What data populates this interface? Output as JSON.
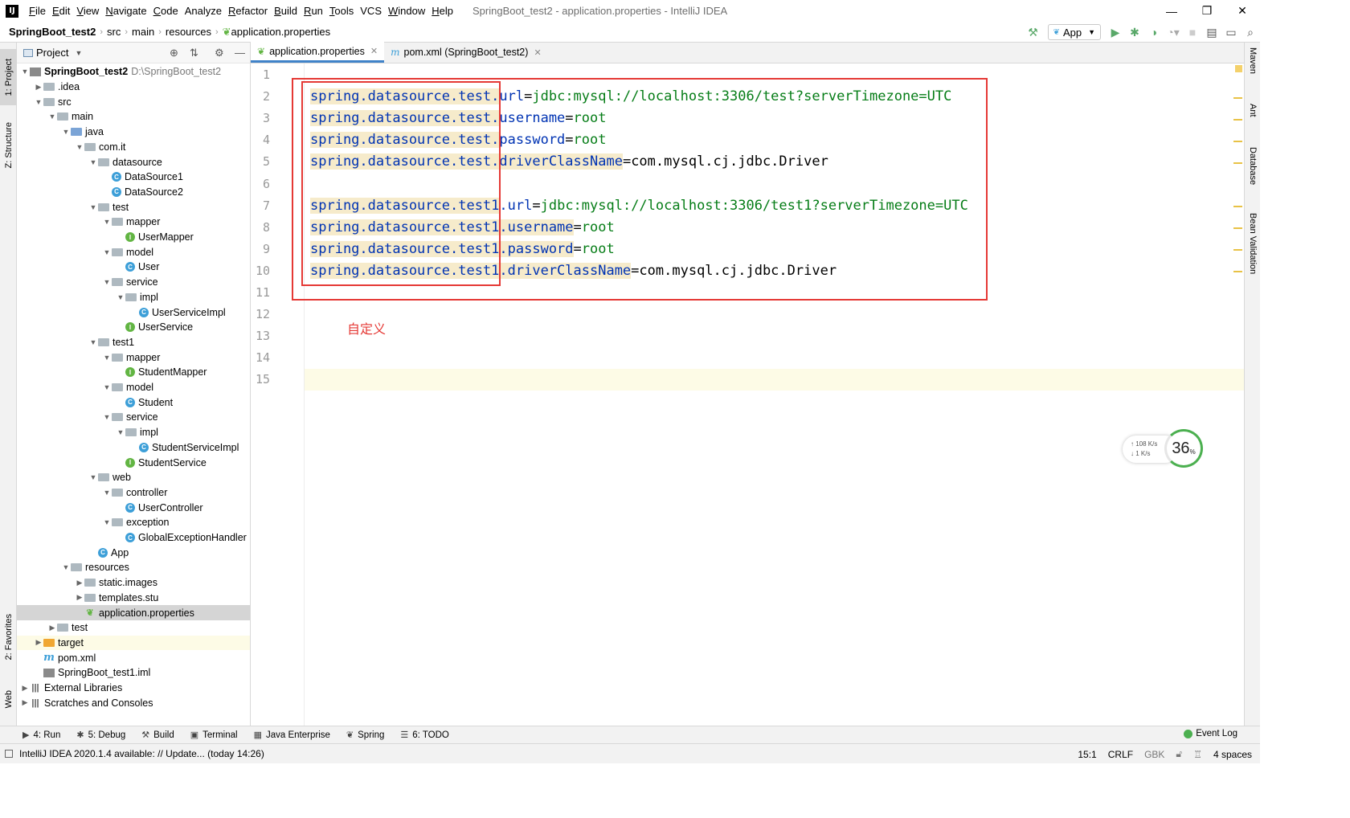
{
  "menubar": {
    "logo": "IJ",
    "items": [
      {
        "label": "File",
        "mnemonic": "F",
        "rest": "ile"
      },
      {
        "label": "Edit",
        "mnemonic": "E",
        "rest": "dit"
      },
      {
        "label": "View",
        "mnemonic": "V",
        "rest": "iew"
      },
      {
        "label": "Navigate",
        "mnemonic": "N",
        "rest": "avigate"
      },
      {
        "label": "Code",
        "mnemonic": "C",
        "rest": "ode"
      },
      {
        "label": "Analyze",
        "mnemonic": "",
        "rest": "Analyze"
      },
      {
        "label": "Refactor",
        "mnemonic": "R",
        "rest": "efactor"
      },
      {
        "label": "Build",
        "mnemonic": "B",
        "rest": "uild"
      },
      {
        "label": "Run",
        "mnemonic": "R",
        "rest": "un"
      },
      {
        "label": "Tools",
        "mnemonic": "T",
        "rest": "ools"
      },
      {
        "label": "VCS",
        "mnemonic": "",
        "rest": "VCS"
      },
      {
        "label": "Window",
        "mnemonic": "W",
        "rest": "indow"
      },
      {
        "label": "Help",
        "mnemonic": "H",
        "rest": "elp"
      }
    ],
    "window_title": "SpringBoot_test2 - application.properties - IntelliJ IDEA",
    "window_buttons": [
      "—",
      "❐",
      "✕"
    ]
  },
  "navbar": {
    "crumbs": [
      "SpringBoot_test2",
      "src",
      "main",
      "resources",
      "application.properties"
    ],
    "run_config": "App"
  },
  "project_panel": {
    "title": "Project",
    "tree": [
      {
        "depth": 0,
        "arrow": "open",
        "icon": "module",
        "label": "SpringBoot_test2",
        "sub": "D:\\SpringBoot_test2",
        "bold": true
      },
      {
        "depth": 1,
        "arrow": "closed",
        "icon": "folder",
        "label": ".idea"
      },
      {
        "depth": 1,
        "arrow": "open",
        "icon": "folder",
        "label": "src"
      },
      {
        "depth": 2,
        "arrow": "open",
        "icon": "folder",
        "label": "main"
      },
      {
        "depth": 3,
        "arrow": "open",
        "icon": "folder-blue",
        "label": "java"
      },
      {
        "depth": 4,
        "arrow": "open",
        "icon": "folder",
        "label": "com.it"
      },
      {
        "depth": 5,
        "arrow": "open",
        "icon": "folder",
        "label": "datasource"
      },
      {
        "depth": 6,
        "arrow": "none",
        "icon": "cls",
        "label": "DataSource1"
      },
      {
        "depth": 6,
        "arrow": "none",
        "icon": "cls",
        "label": "DataSource2"
      },
      {
        "depth": 5,
        "arrow": "open",
        "icon": "folder",
        "label": "test"
      },
      {
        "depth": 6,
        "arrow": "open",
        "icon": "folder",
        "label": "mapper"
      },
      {
        "depth": 7,
        "arrow": "none",
        "icon": "intf",
        "label": "UserMapper"
      },
      {
        "depth": 6,
        "arrow": "open",
        "icon": "folder",
        "label": "model"
      },
      {
        "depth": 7,
        "arrow": "none",
        "icon": "cls",
        "label": "User"
      },
      {
        "depth": 6,
        "arrow": "open",
        "icon": "folder",
        "label": "service"
      },
      {
        "depth": 7,
        "arrow": "open",
        "icon": "folder",
        "label": "impl"
      },
      {
        "depth": 8,
        "arrow": "none",
        "icon": "cls",
        "label": "UserServiceImpl"
      },
      {
        "depth": 7,
        "arrow": "none",
        "icon": "intf",
        "label": "UserService"
      },
      {
        "depth": 5,
        "arrow": "open",
        "icon": "folder",
        "label": "test1"
      },
      {
        "depth": 6,
        "arrow": "open",
        "icon": "folder",
        "label": "mapper"
      },
      {
        "depth": 7,
        "arrow": "none",
        "icon": "intf",
        "label": "StudentMapper"
      },
      {
        "depth": 6,
        "arrow": "open",
        "icon": "folder",
        "label": "model"
      },
      {
        "depth": 7,
        "arrow": "none",
        "icon": "cls",
        "label": "Student"
      },
      {
        "depth": 6,
        "arrow": "open",
        "icon": "folder",
        "label": "service"
      },
      {
        "depth": 7,
        "arrow": "open",
        "icon": "folder",
        "label": "impl"
      },
      {
        "depth": 8,
        "arrow": "none",
        "icon": "cls",
        "label": "StudentServiceImpl"
      },
      {
        "depth": 7,
        "arrow": "none",
        "icon": "intf",
        "label": "StudentService"
      },
      {
        "depth": 5,
        "arrow": "open",
        "icon": "folder",
        "label": "web"
      },
      {
        "depth": 6,
        "arrow": "open",
        "icon": "folder",
        "label": "controller"
      },
      {
        "depth": 7,
        "arrow": "none",
        "icon": "cls",
        "label": "UserController"
      },
      {
        "depth": 6,
        "arrow": "open",
        "icon": "folder",
        "label": "exception"
      },
      {
        "depth": 7,
        "arrow": "none",
        "icon": "cls",
        "label": "GlobalExceptionHandler"
      },
      {
        "depth": 5,
        "arrow": "none",
        "icon": "cls",
        "label": "App"
      },
      {
        "depth": 3,
        "arrow": "open",
        "icon": "folder",
        "label": "resources"
      },
      {
        "depth": 4,
        "arrow": "closed",
        "icon": "folder",
        "label": "static.images"
      },
      {
        "depth": 4,
        "arrow": "closed",
        "icon": "folder",
        "label": "templates.stu"
      },
      {
        "depth": 4,
        "arrow": "none",
        "icon": "props",
        "label": "application.properties",
        "selected": true
      },
      {
        "depth": 2,
        "arrow": "closed",
        "icon": "folder",
        "label": "test"
      },
      {
        "depth": 1,
        "arrow": "closed",
        "icon": "folder-orange",
        "label": "target",
        "highlight": true
      },
      {
        "depth": 1,
        "arrow": "none",
        "icon": "maven",
        "label": "pom.xml"
      },
      {
        "depth": 1,
        "arrow": "none",
        "icon": "module",
        "label": "SpringBoot_test1.iml"
      },
      {
        "depth": 0,
        "arrow": "closed",
        "icon": "libs",
        "label": "External Libraries"
      },
      {
        "depth": 0,
        "arrow": "closed",
        "icon": "libs",
        "label": "Scratches and Consoles"
      }
    ]
  },
  "left_stripe": {
    "tabs": [
      "1: Project",
      "Z: Structure",
      "2: Favorites",
      "Web"
    ]
  },
  "editor_tabs": [
    {
      "label": "application.properties",
      "active": true
    },
    {
      "label": "pom.xml (SpringBoot_test2)",
      "active": false
    }
  ],
  "editor": {
    "line_numbers": [
      "1",
      "2",
      "3",
      "4",
      "5",
      "6",
      "7",
      "8",
      "9",
      "10",
      "11",
      "12",
      "13",
      "14",
      "15"
    ],
    "lines": [
      [],
      [
        {
          "t": "spring.datasource.test.",
          "c": "k"
        },
        {
          "t": "url",
          "c": "k2"
        },
        {
          "t": "=",
          "c": "eq"
        },
        {
          "t": "jdbc:mysql://localhost:3306/test?serverTimezone=UTC",
          "c": "v"
        }
      ],
      [
        {
          "t": "spring.datasource.test.",
          "c": "k"
        },
        {
          "t": "username",
          "c": "k2"
        },
        {
          "t": "=",
          "c": "eq"
        },
        {
          "t": "root",
          "c": "v"
        }
      ],
      [
        {
          "t": "spring.datasource.test.",
          "c": "k"
        },
        {
          "t": "password",
          "c": "k2"
        },
        {
          "t": "=",
          "c": "eq"
        },
        {
          "t": "root",
          "c": "v"
        }
      ],
      [
        {
          "t": "spring.datasource.test.",
          "c": "k"
        },
        {
          "t": "driverClassName",
          "c": "k"
        },
        {
          "t": "=",
          "c": "eq"
        },
        {
          "t": "com.mysql.cj.jdbc.Driver",
          "c": "vb"
        }
      ],
      [],
      [
        {
          "t": "spring.datasource.test1",
          "c": "k"
        },
        {
          "t": ".url",
          "c": "k2"
        },
        {
          "t": "=",
          "c": "eq"
        },
        {
          "t": "jdbc:mysql://localhost:3306/test1?serverTimezone=UTC",
          "c": "v"
        }
      ],
      [
        {
          "t": "spring.datasource.test1",
          "c": "k"
        },
        {
          "t": ".username",
          "c": "k"
        },
        {
          "t": "=",
          "c": "eq"
        },
        {
          "t": "root",
          "c": "v"
        }
      ],
      [
        {
          "t": "spring.datasource.test1",
          "c": "k"
        },
        {
          "t": ".password",
          "c": "k"
        },
        {
          "t": "=",
          "c": "eq"
        },
        {
          "t": "root",
          "c": "v"
        }
      ],
      [
        {
          "t": "spring.datasource.test1",
          "c": "k"
        },
        {
          "t": ".driverClassName",
          "c": "k"
        },
        {
          "t": "=",
          "c": "eq"
        },
        {
          "t": "com.mysql.cj.jdbc.Driver",
          "c": "vb"
        }
      ],
      [],
      [],
      [],
      [],
      []
    ],
    "annotation": "自定义"
  },
  "net_widget": {
    "up": "↑ 108 K/s",
    "down": "↓ 1   K/s",
    "percent": "36",
    "percent_sign": "%"
  },
  "right_stripe": {
    "tabs": [
      "Maven",
      "Ant",
      "Database",
      "Bean Validation"
    ]
  },
  "bottom_tools": [
    {
      "icon": "▶",
      "label": "4: Run"
    },
    {
      "icon": "✱",
      "label": "5: Debug"
    },
    {
      "icon": "⚒",
      "label": "Build"
    },
    {
      "icon": "▣",
      "label": "Terminal"
    },
    {
      "icon": "▦",
      "label": "Java Enterprise"
    },
    {
      "icon": "❦",
      "label": "Spring"
    },
    {
      "icon": "☰",
      "label": "6: TODO"
    }
  ],
  "event_log": "Event Log",
  "statusbar": {
    "message": "IntelliJ IDEA 2020.1.4 available: // Update... (today 14:26)",
    "position": "15:1",
    "line_sep": "CRLF",
    "encoding": "GBK",
    "indent": "4 spaces"
  },
  "colors": {
    "accent": "#4083c9",
    "annotation_red": "#e53935",
    "key_highlight": "#f6ebcb",
    "value_green": "#067d17",
    "key_blue": "#0033b3"
  }
}
